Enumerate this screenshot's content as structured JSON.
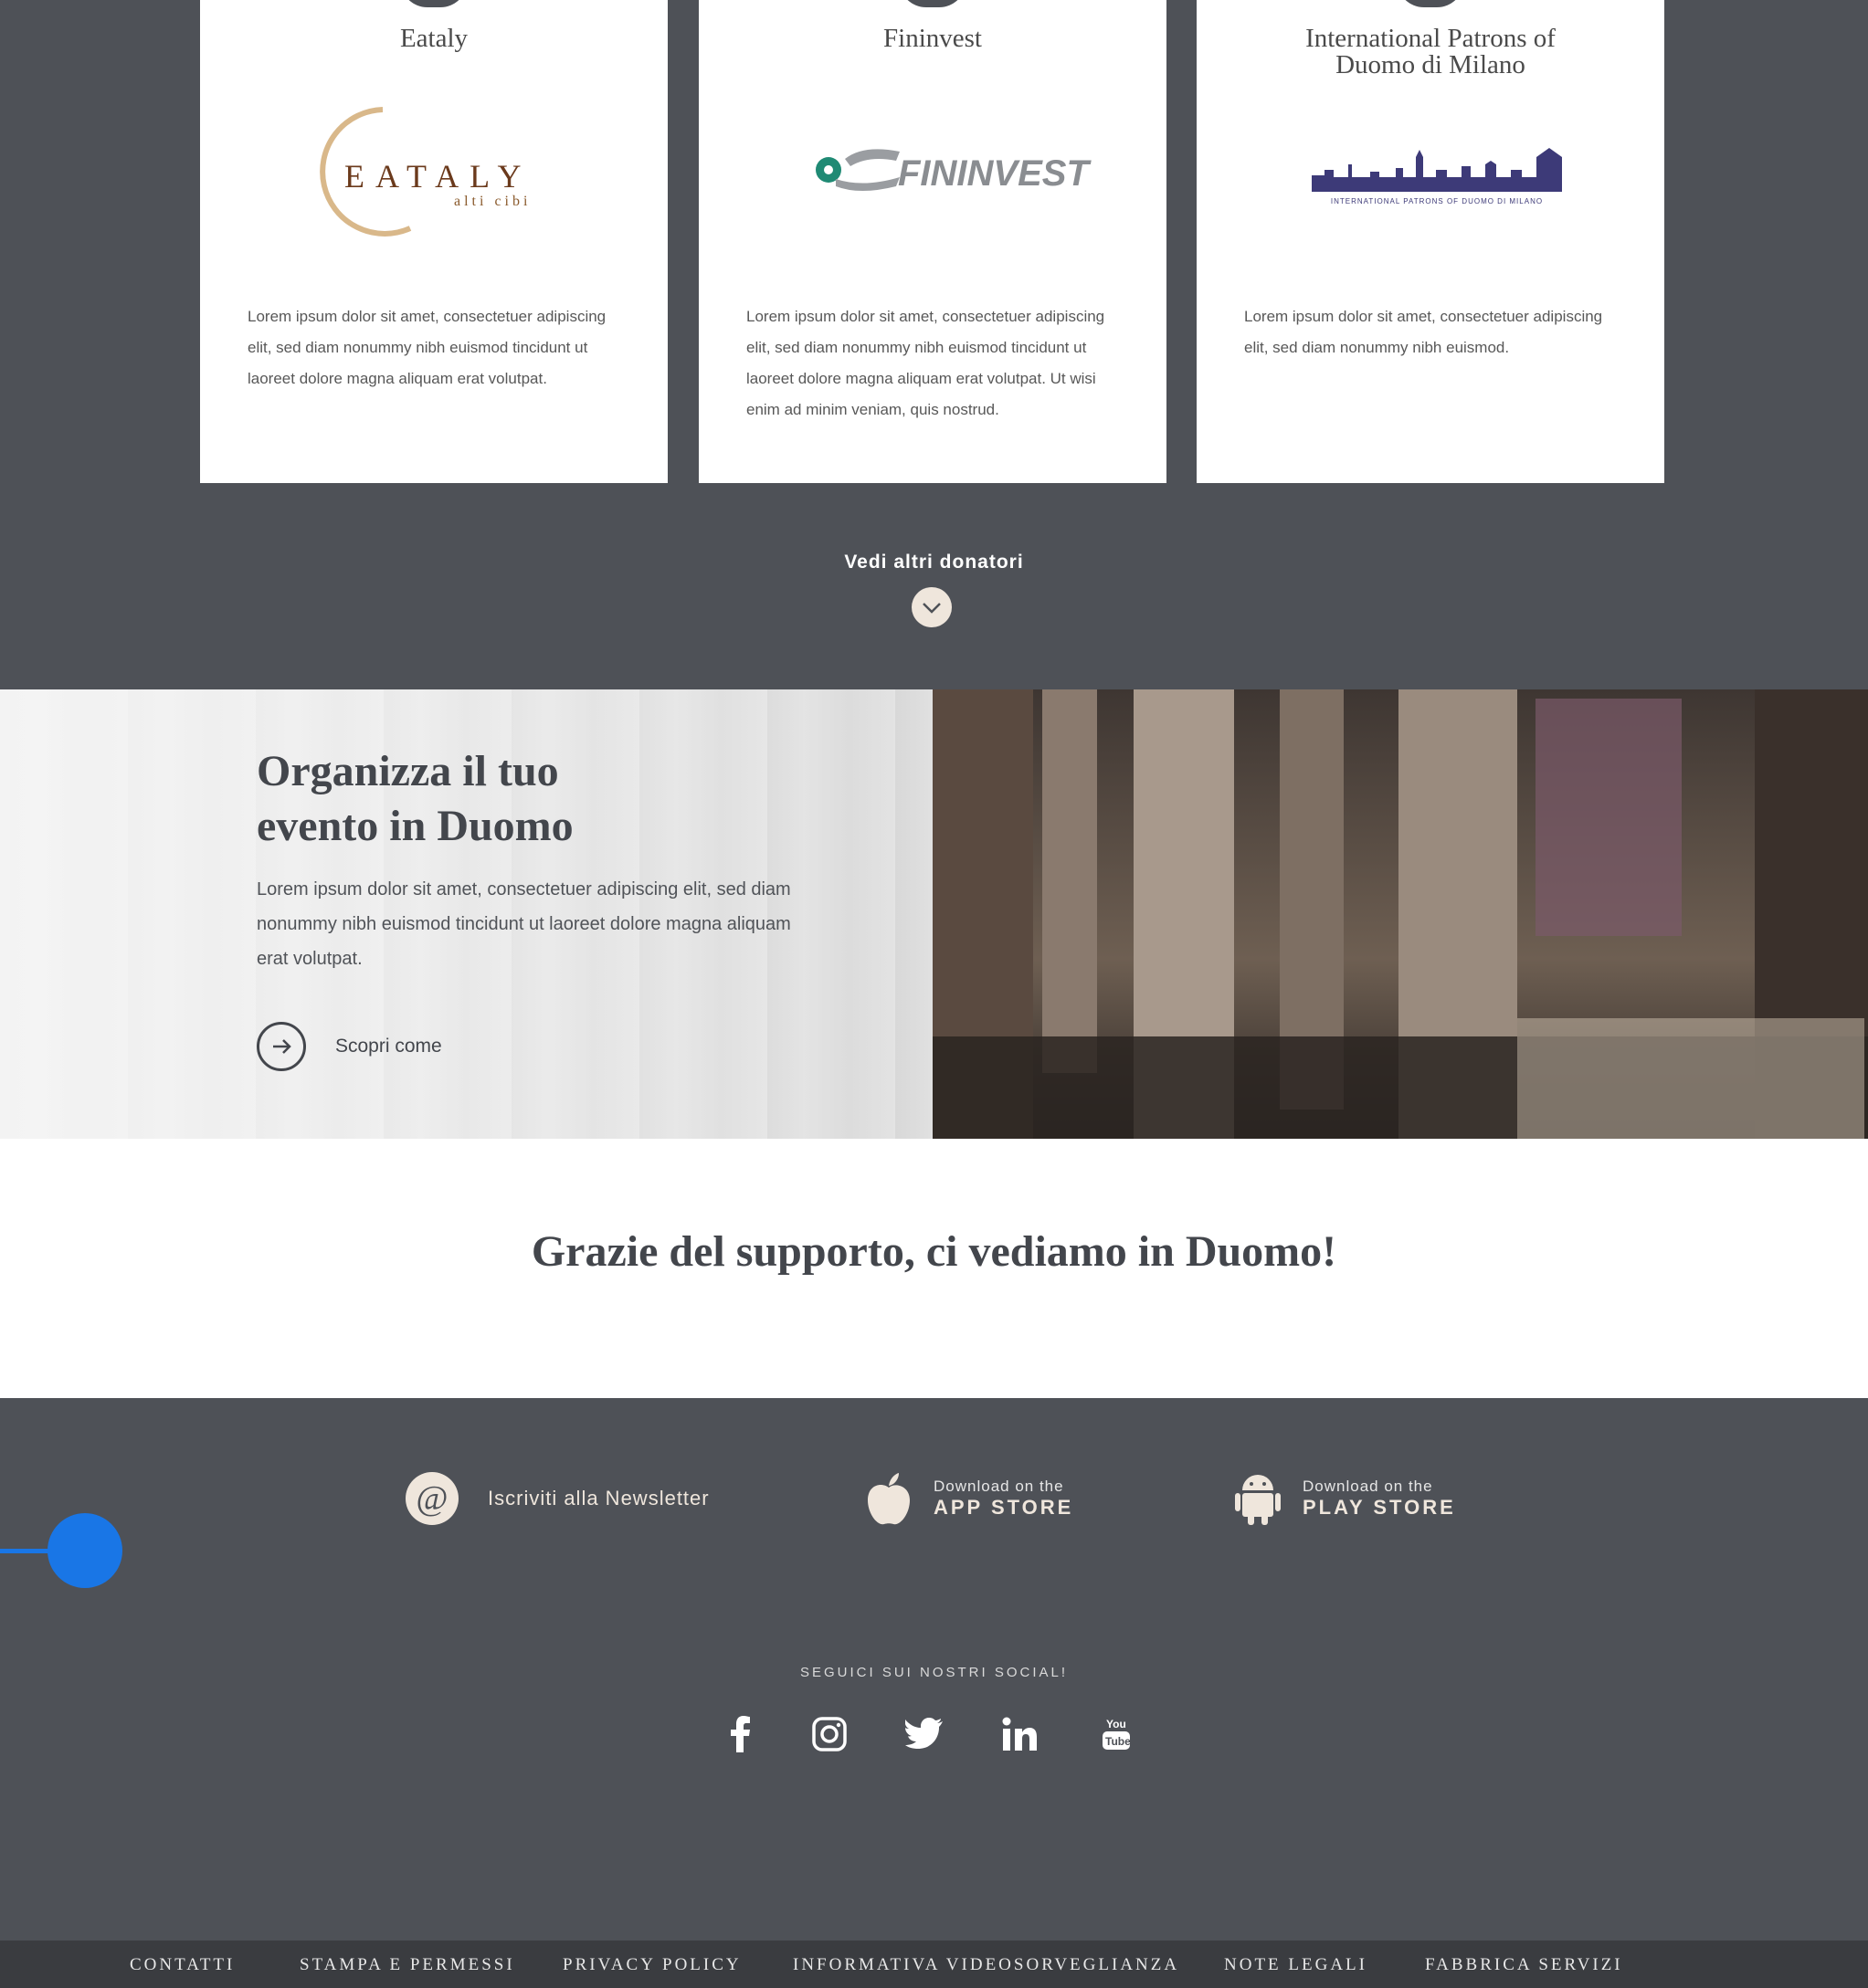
{
  "donors": {
    "cards": [
      {
        "name": "Eataly",
        "logo_text": "EATALY",
        "logo_sub": "alti cibi",
        "logo_color": "#6b3a1c",
        "text": "Lorem ipsum dolor sit amet, consectetuer adipiscing elit, sed diam nonummy nibh euismod tincidunt ut laoreet dolore magna aliquam erat volutpat."
      },
      {
        "name": "Fininvest",
        "logo_text": "FININVEST",
        "logo_color": "#8a8d91",
        "text": "Lorem ipsum dolor sit amet, consectetuer adipiscing elit, sed diam nonummy nibh euismod tincidunt ut laoreet dolore magna aliquam erat volutpat. Ut wisi enim ad minim veniam, quis nostrud."
      },
      {
        "name": "International Patrons of Duomo di Milano",
        "logo_text": "INTERNATIONAL PATRONS OF DUOMO DI MILANO",
        "logo_color": "#3d3a78",
        "text": "Lorem ipsum dolor sit amet, consectetuer adipiscing elit, sed diam nonummy nibh euismod."
      }
    ],
    "more_label": "Vedi altri donatori"
  },
  "event": {
    "title_line1": "Organizza il tuo",
    "title_line2": "evento in Duomo",
    "text": "Lorem ipsum dolor sit amet, consectetuer adipiscing elit, sed diam nonummy nibh euismod tincidunt ut laoreet dolore magna aliquam erat volutpat.",
    "cta_label": "Scopri come"
  },
  "thanks": {
    "title": "Grazie del supporto, ci vediamo in Duomo!"
  },
  "footer": {
    "newsletter_label": "Iscriviti alla Newsletter",
    "newsletter_icon": "@",
    "appstore_small": "Download on the",
    "appstore_big": "APP STORE",
    "playstore_small": "Download on the",
    "playstore_big": "PLAY STORE",
    "social_label": "SEGUICI SUI NOSTRI SOCIAL!",
    "socials": [
      "facebook-icon",
      "instagram-icon",
      "twitter-icon",
      "linkedin-icon",
      "youtube-icon"
    ]
  },
  "bottom_nav": [
    "CONTATTI",
    "STAMPA E PERMESSI",
    "PRIVACY POLICY",
    "INFORMATIVA VIDEOSORVEGLIANZA",
    "NOTE LEGALI",
    "FABBRICA SERVIZI"
  ],
  "colors": {
    "dark": "#4e5157",
    "accent": "#efe6dc",
    "blue": "#1976e6"
  }
}
